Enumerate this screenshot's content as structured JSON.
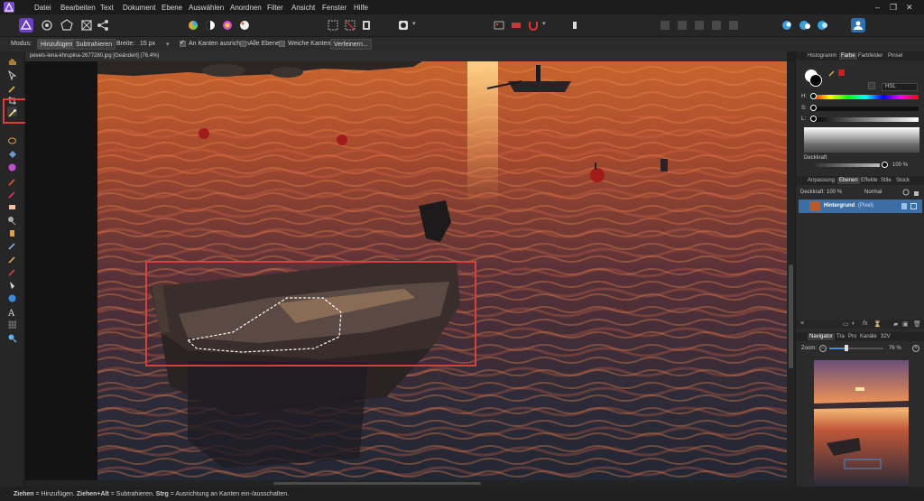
{
  "menu": {
    "items": [
      "Datei",
      "Bearbeiten",
      "Text",
      "Dokument",
      "Ebene",
      "Auswählen",
      "Anordnen",
      "Filter",
      "Ansicht",
      "Fenster",
      "Hilfe"
    ],
    "window_controls": [
      "–",
      "❐",
      "✕"
    ]
  },
  "context_toolbar": {
    "mode_label": "Modus:",
    "add_label": "Hinzufügen",
    "subtract_label": "Subtrahieren",
    "width_label": "Breite:",
    "width_value": "15 px",
    "snap_edges_label": "An Kanten ausrichten",
    "all_layers_label": "Alle Ebenen",
    "soft_edges_label": "Weiche Kanten",
    "refine_label": "Verfeinern..."
  },
  "document": {
    "tab_title": "pexels-lena-khrupina-2677280.jpg [Geändert] (76.4%)"
  },
  "color_panel": {
    "tabs": [
      "Histogramm",
      "Farbe",
      "Farbfelder",
      "Pinsel"
    ],
    "active_tab": "Farbe",
    "model": "HSL",
    "h_label": "H:",
    "s_label": "S:",
    "l_label": "L:",
    "opacity_label": "Deckkraft",
    "opacity_value": "100 %",
    "primary_color": "#000000",
    "secondary_color": "#ffffff",
    "accent_color": "#d01c1c"
  },
  "layers_panel": {
    "tabs": [
      "Anpassung",
      "Ebenen",
      "Effekte",
      "Stile",
      "Stock"
    ],
    "active_tab": "Ebenen",
    "opacity_label": "Deckkraft:",
    "opacity_value": "100 %",
    "blend_mode": "Normal",
    "layer_name": "Hintergrund",
    "layer_type": "(Pixel)"
  },
  "navigator_panel": {
    "tabs": [
      "Navigator",
      "Tra",
      "Pro",
      "Kanäle",
      "32V"
    ],
    "active_tab": "Navigator",
    "zoom_label": "Zoom:",
    "zoom_value": "76 %"
  },
  "status": {
    "part1_bold": "Ziehen",
    "part1": " = Hinzufügen. ",
    "part2_bold": "Ziehen+Alt",
    "part2": " = Subtrahieren. ",
    "part3_bold": "Strg",
    "part3": " = Ausrichtung an Kanten ein-/ausschalten."
  },
  "colors": {
    "accent": "#8b5cf6",
    "highlight_red": "#e03b3b",
    "layer_selected": "#3a6ea5"
  }
}
